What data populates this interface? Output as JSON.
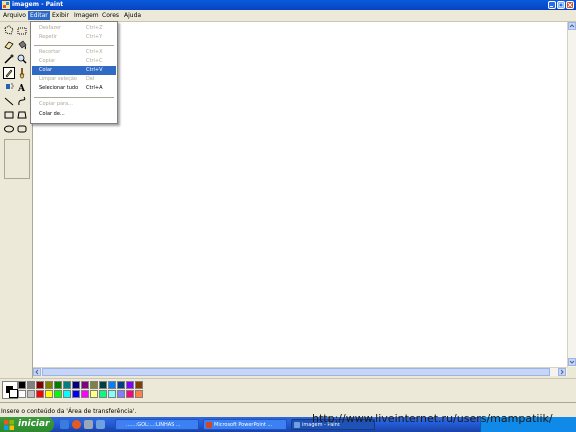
{
  "window": {
    "title": "imagem - Paint",
    "icon": "paint-icon"
  },
  "menubar": {
    "items": [
      "Arquivo",
      "Editar",
      "Exibir",
      "Imagem",
      "Cores",
      "Ajuda"
    ],
    "open": "Editar"
  },
  "edit_menu": {
    "groups": [
      [
        {
          "label": "Desfazer",
          "shortcut": "Ctrl+Z",
          "enabled": false
        },
        {
          "label": "Repetir",
          "shortcut": "Ctrl+Y",
          "enabled": false
        }
      ],
      [
        {
          "label": "Recortar",
          "shortcut": "Ctrl+X",
          "enabled": false
        },
        {
          "label": "Copiar",
          "shortcut": "Ctrl+C",
          "enabled": false
        },
        {
          "label": "Colar",
          "shortcut": "Ctrl+V",
          "enabled": true,
          "highlighted": true
        },
        {
          "label": "Limpar seleção",
          "shortcut": "Del",
          "enabled": false
        },
        {
          "label": "Selecionar tudo",
          "shortcut": "Ctrl+A",
          "enabled": true
        }
      ],
      [
        {
          "label": "Copiar para...",
          "shortcut": "",
          "enabled": false
        },
        {
          "label": "Colar de...",
          "shortcut": "",
          "enabled": true
        }
      ]
    ]
  },
  "tools": [
    "free-form-select-icon",
    "select-icon",
    "eraser-icon",
    "fill-icon",
    "color-picker-icon",
    "magnifier-icon",
    "pencil-icon",
    "brush-icon",
    "airbrush-icon",
    "text-icon",
    "line-icon",
    "curve-icon",
    "rectangle-icon",
    "polygon-icon",
    "ellipse-icon",
    "rounded-rectangle-icon"
  ],
  "active_tool": "pencil-icon",
  "palette": {
    "foreground": "#000000",
    "background": "#ffffff",
    "colors": [
      "#000000",
      "#808080",
      "#800000",
      "#808000",
      "#008000",
      "#008080",
      "#000080",
      "#800080",
      "#808040",
      "#004040",
      "#0080ff",
      "#004080",
      "#8000ff",
      "#804000",
      "#ffffff",
      "#c0c0c0",
      "#ff0000",
      "#ffff00",
      "#00ff00",
      "#00ffff",
      "#0000ff",
      "#ff00ff",
      "#ffff80",
      "#00ff80",
      "#80ffff",
      "#8080ff",
      "#ff0080",
      "#ff8040"
    ]
  },
  "status": {
    "text": "Insere o conteúdo da 'Área de transferência'."
  },
  "taskbar": {
    "start_label": "iniciar",
    "buttons": [
      {
        "label": "......:GOL:...:LINHAS ...",
        "color": "#4a7cf0",
        "active": false
      },
      {
        "label": "Microsoft PowerPoint ...",
        "color": "#d24726",
        "active": false
      },
      {
        "label": "imagem - Paint",
        "color": "#6fa0e0",
        "active": true
      }
    ]
  },
  "watermark": "http://www.liveinternet.ru/users/mampatiik/"
}
